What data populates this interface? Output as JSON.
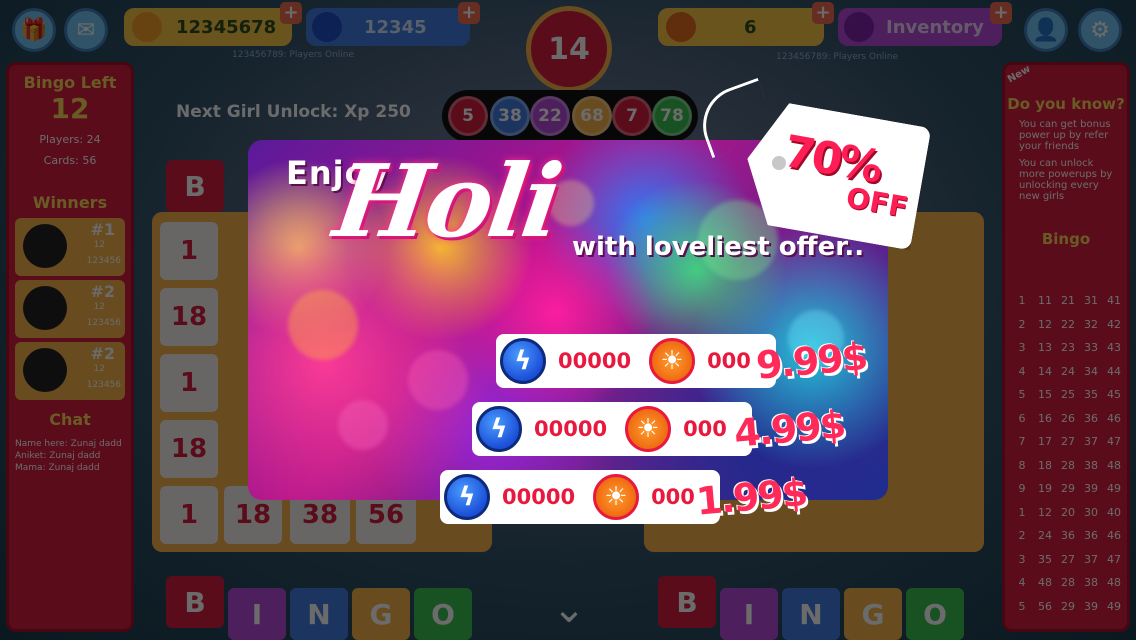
{
  "top_bar": {
    "coins_value": "12345678",
    "energy_value": "12345",
    "players_online_left": "123456789: Players Online",
    "players_online_right": "123456789: Players Online",
    "timer_value": "14",
    "powerup_value": "6",
    "inventory_label": "Inventory"
  },
  "left_panel": {
    "bingo_left_label": "Bingo Left",
    "bingo_left_value": "12",
    "players_text": "Players: 24",
    "cards_text": "Cards: 56",
    "winners_label": "Winners",
    "winners": [
      {
        "rank": "#1",
        "score": "12",
        "points": "123456"
      },
      {
        "rank": "#2",
        "score": "12",
        "points": "123456"
      },
      {
        "rank": "#2",
        "score": "12",
        "points": "123456"
      }
    ],
    "chat_label": "Chat",
    "chat_lines": [
      "Name here: Zunaj dadd",
      "Aniket: Zunaj dadd",
      "Mama: Zunaj dadd"
    ]
  },
  "center": {
    "next_unlock_text": "Next Girl Unlock: Xp 250",
    "called_balls": [
      "5",
      "38",
      "22",
      "68",
      "7",
      "78"
    ],
    "card_numbers_left": [
      "1",
      "18",
      "1",
      "18",
      "1",
      "18",
      "38",
      "56"
    ],
    "bingo_letters": [
      "B",
      "I",
      "N",
      "G",
      "O"
    ]
  },
  "right_panel": {
    "new_badge": "New",
    "did_you_know_label": "Do you know?",
    "tips": [
      "You can get bonus power up by refer your friends",
      "You can unlock more powerups by unlocking every new girls"
    ],
    "bingo_label": "Bingo",
    "grid_rows": [
      [
        "1",
        "11",
        "21",
        "31",
        "41"
      ],
      [
        "2",
        "12",
        "22",
        "32",
        "42"
      ],
      [
        "3",
        "13",
        "23",
        "33",
        "43"
      ],
      [
        "4",
        "14",
        "24",
        "34",
        "44"
      ],
      [
        "5",
        "15",
        "25",
        "35",
        "45"
      ],
      [
        "6",
        "16",
        "26",
        "36",
        "46"
      ],
      [
        "7",
        "17",
        "27",
        "37",
        "47"
      ],
      [
        "8",
        "18",
        "28",
        "38",
        "48"
      ],
      [
        "9",
        "19",
        "29",
        "39",
        "49"
      ],
      [
        "1",
        "12",
        "20",
        "30",
        "40"
      ],
      [
        "2",
        "24",
        "36",
        "36",
        "46"
      ],
      [
        "3",
        "35",
        "27",
        "37",
        "47"
      ],
      [
        "4",
        "48",
        "28",
        "38",
        "48"
      ],
      [
        "5",
        "56",
        "29",
        "39",
        "49"
      ]
    ]
  },
  "popup": {
    "enjoy_text": "Enjoy",
    "holi_text": "Holi",
    "subtitle_text": "with loveliest offer..",
    "tag_percent": "70%",
    "tag_off": "OFF",
    "offers": [
      {
        "energy_qty": "00000",
        "coin_qty": "000",
        "price": "9.99$"
      },
      {
        "energy_qty": "00000",
        "coin_qty": "000",
        "price": "4.99$"
      },
      {
        "energy_qty": "00000",
        "coin_qty": "000",
        "price": "1.99$"
      }
    ]
  }
}
